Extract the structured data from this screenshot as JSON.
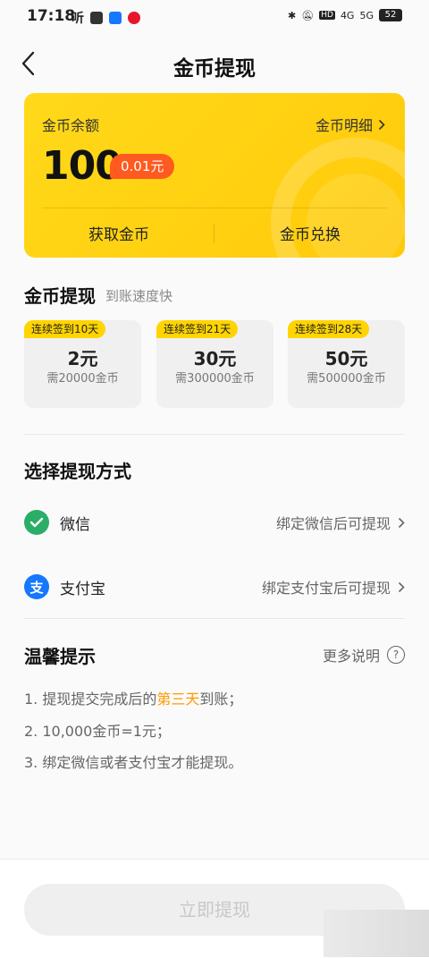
{
  "status_bar": {
    "time": "17:18",
    "left_app_glyph": "听",
    "network_hd": "HD",
    "network_4g": "4G",
    "network_5g": "5G",
    "battery": "52"
  },
  "header": {
    "title": "金币提现"
  },
  "coin_card": {
    "balance_label": "金币余额",
    "detail_link": "金币明细",
    "balance": "100",
    "cash_value": "0.01元",
    "get_coins": "获取金币",
    "exchange_coins": "金币兑换"
  },
  "withdraw_section": {
    "title": "金币提现",
    "subtitle": "到账速度快",
    "options": [
      {
        "badge": "连续签到10天",
        "amount": "2元",
        "need": "需20000金币"
      },
      {
        "badge": "连续签到21天",
        "amount": "30元",
        "need": "需300000金币"
      },
      {
        "badge": "连续签到28天",
        "amount": "50元",
        "need": "需500000金币"
      }
    ]
  },
  "method_section": {
    "title": "选择提现方式",
    "wechat": {
      "name": "微信",
      "hint": "绑定微信后可提现"
    },
    "alipay": {
      "name": "支付宝",
      "hint": "绑定支付宝后可提现"
    }
  },
  "tips": {
    "title": "温馨提示",
    "more": "更多说明",
    "line1_prefix": "1. 提现提交完成后的",
    "line1_highlight": "第三天",
    "line1_suffix": "到账；",
    "line2": "2. 10,000金币=1元；",
    "line3": "3. 绑定微信或者支付宝才能提现。"
  },
  "footer": {
    "submit": "立即提现"
  },
  "colors": {
    "accent_yellow": "#ffd400",
    "cash_badge": "#ff5a1f",
    "wechat_green": "#2aae67",
    "alipay_blue": "#1677ff",
    "highlight_orange": "#ff9900"
  }
}
